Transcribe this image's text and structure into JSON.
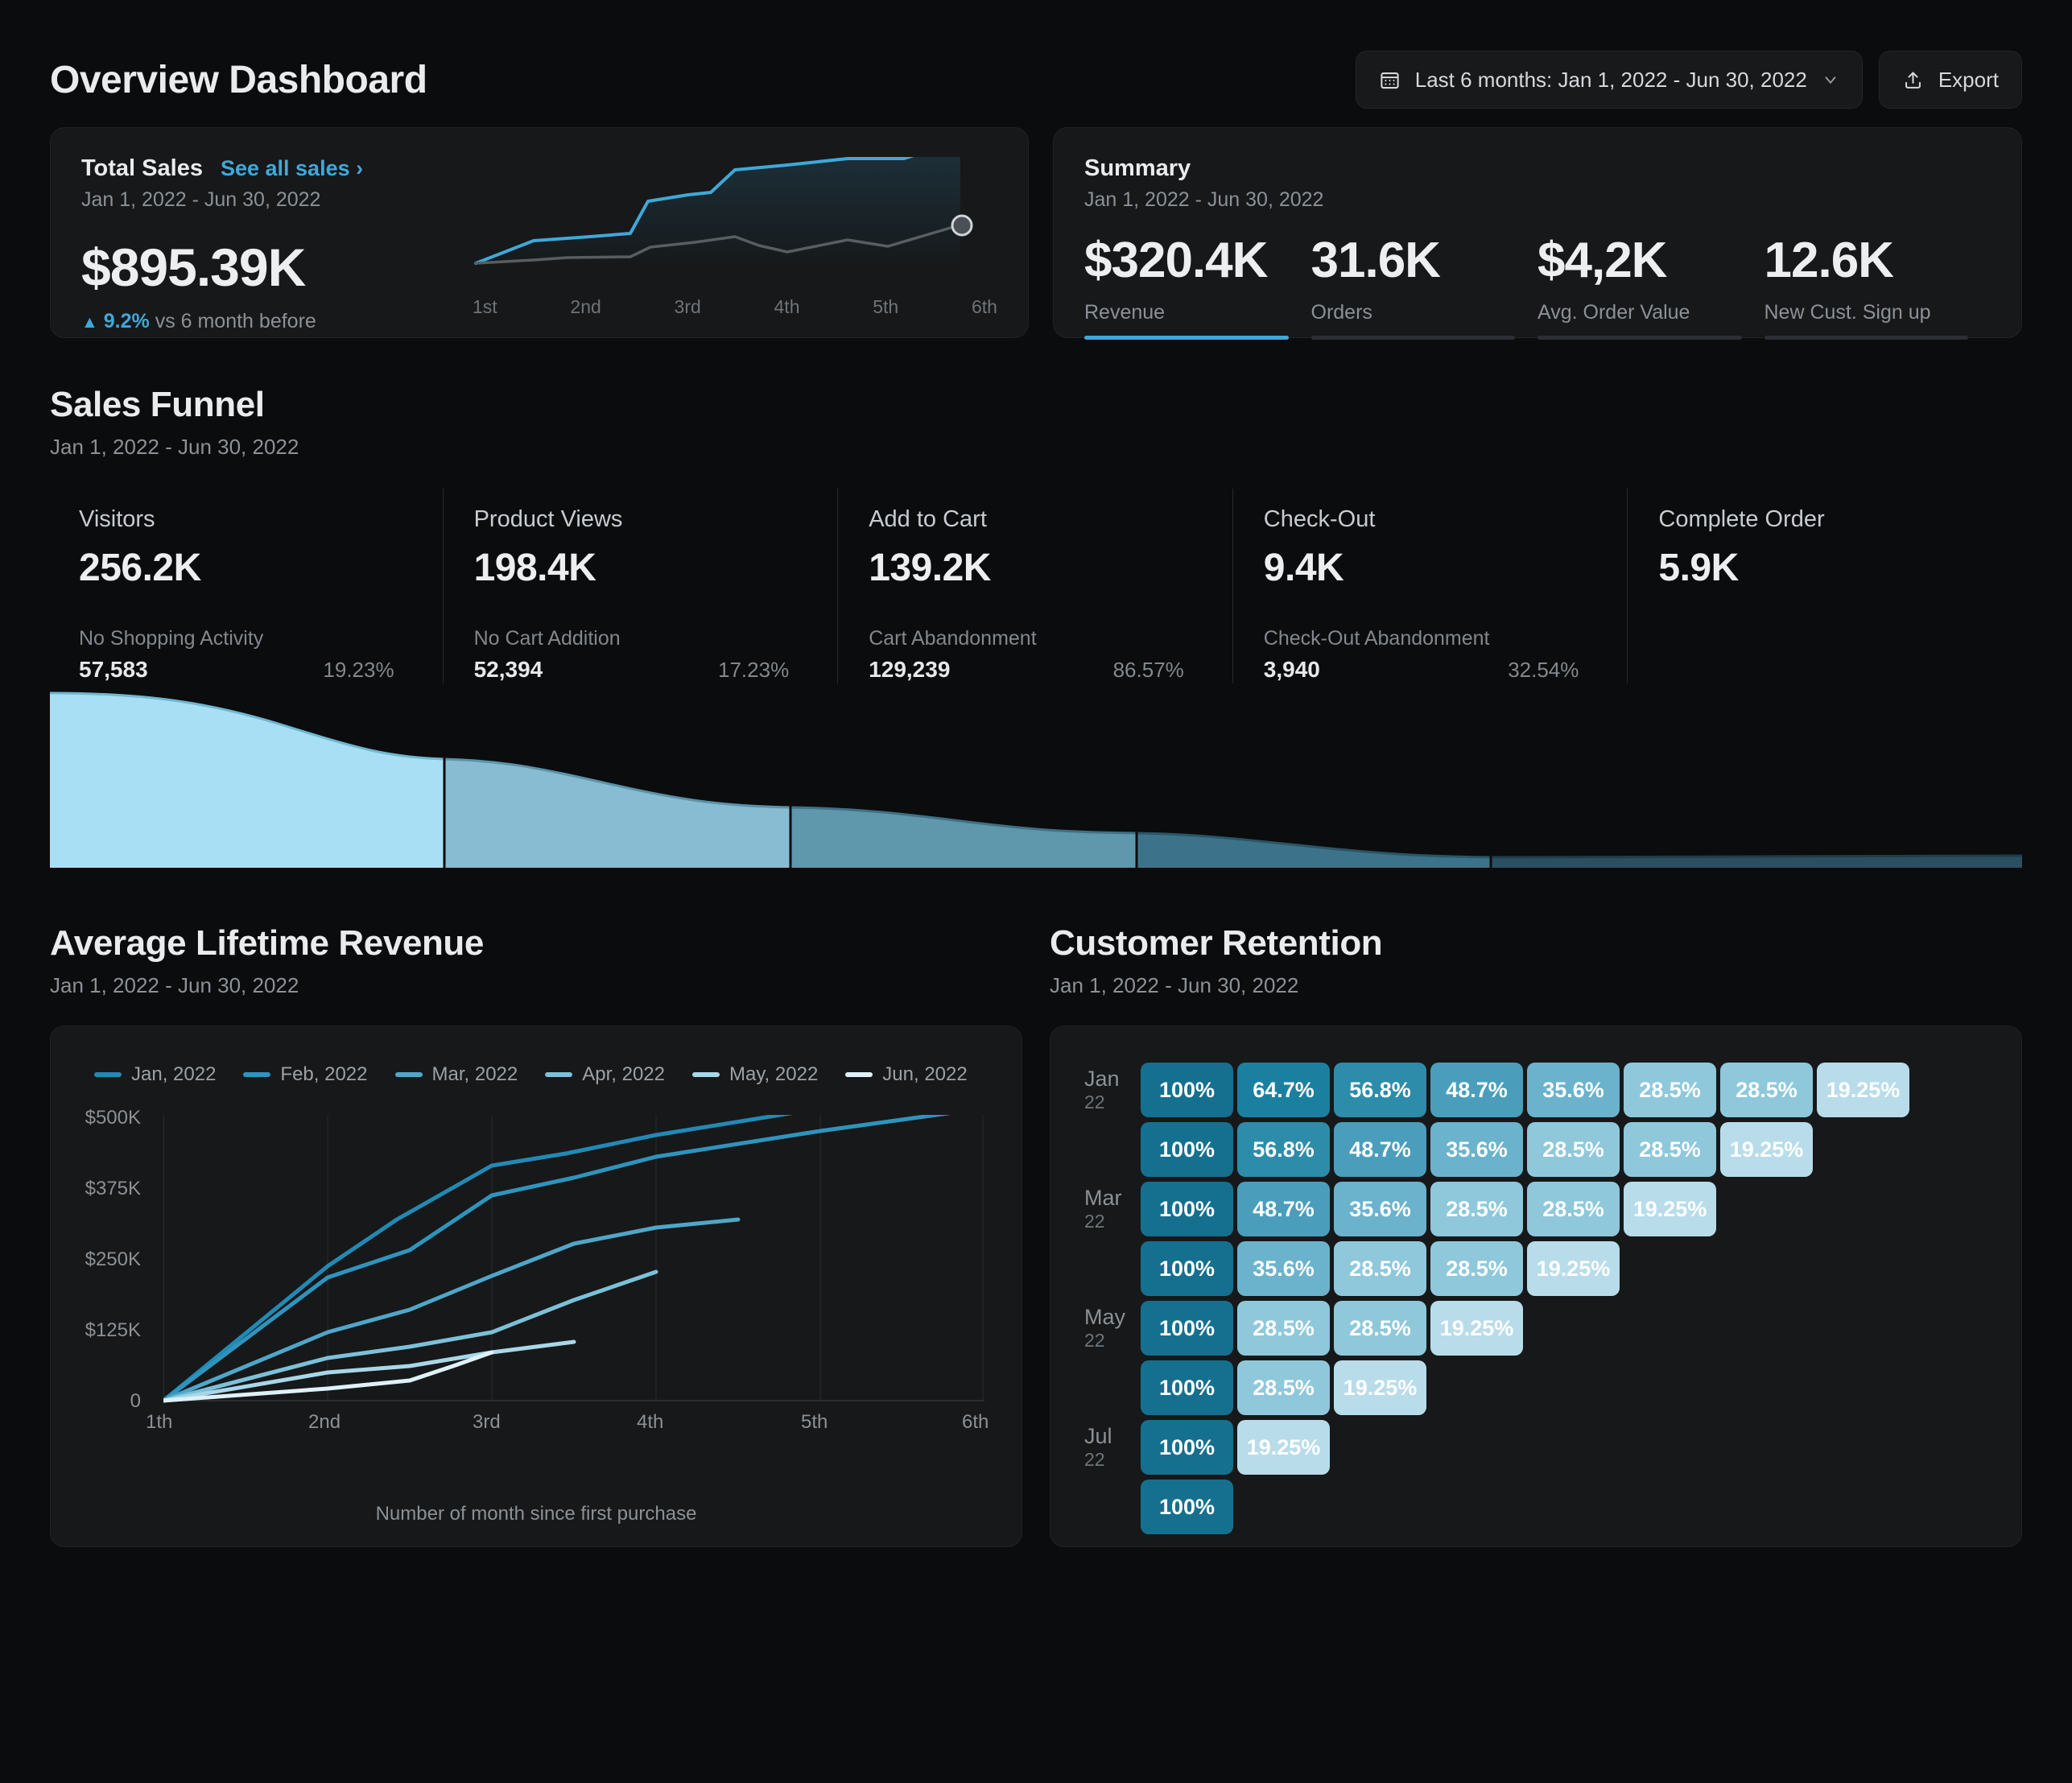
{
  "header": {
    "title": "Overview Dashboard",
    "date_picker": {
      "label": "Last 6 months: Jan 1, 2022 - Jun 30, 2022",
      "icon": "calendar-icon",
      "chevron": "∨"
    },
    "export": {
      "label": "Export",
      "icon": "upload-icon"
    }
  },
  "total_sales": {
    "title": "Total Sales",
    "link": "See all sales ›",
    "date_range": "Jan 1, 2022 - Jun 30, 2022",
    "value": "$895.39K",
    "delta_arrow": "▲",
    "delta_value": "9.2%",
    "delta_text": "vs 6 month before",
    "x_labels": [
      "1st",
      "2nd",
      "3rd",
      "4th",
      "5th",
      "6th"
    ]
  },
  "summary": {
    "title": "Summary",
    "date_range": "Jan 1, 2022 - Jun 30, 2022",
    "metrics": [
      {
        "value": "$320.4K",
        "label": "Revenue",
        "active": true
      },
      {
        "value": "31.6K",
        "label": "Orders",
        "active": false
      },
      {
        "value": "$4,2K",
        "label": "Avg. Order Value",
        "active": false
      },
      {
        "value": "12.6K",
        "label": "New Cust. Sign up",
        "active": false
      }
    ]
  },
  "sales_funnel": {
    "title": "Sales Funnel",
    "date_range": "Jan 1, 2022 - Jun 30, 2022",
    "stages": [
      {
        "label": "Visitors",
        "value": "256.2K",
        "drop_label": "No Shopping Activity",
        "drop_value": "57,583",
        "drop_pct": "19.23%",
        "color": "#a8dff5"
      },
      {
        "label": "Product Views",
        "value": "198.4K",
        "drop_label": "No Cart Addition",
        "drop_value": "52,394",
        "drop_pct": "17.23%",
        "color": "#87bcd2"
      },
      {
        "label": "Add to Cart",
        "value": "139.2K",
        "drop_label": "Cart Abandonment",
        "drop_value": "129,239",
        "drop_pct": "86.57%",
        "color": "#5f97ad"
      },
      {
        "label": "Check-Out",
        "value": "9.4K",
        "drop_label": "Check-Out Abandonment",
        "drop_value": "3,940",
        "drop_pct": "32.54%",
        "color": "#3c738b"
      },
      {
        "label": "Complete Order",
        "value": "5.9K",
        "drop_label": "",
        "drop_value": "",
        "drop_pct": "",
        "color": "#2a4f61"
      }
    ]
  },
  "lifetime_revenue": {
    "title": "Average Lifetime Revenue",
    "date_range": "Jan 1, 2022 - Jun 30, 2022"
  },
  "retention": {
    "title": "Customer Retention",
    "date_range": "Jan 1, 2022 - Jun 30, 2022"
  },
  "chart_data": [
    {
      "type": "line",
      "name": "total-sales-sparkline",
      "title": "Total Sales",
      "x": [
        "1st",
        "2nd",
        "3rd",
        "4th",
        "5th",
        "6th"
      ],
      "xlabel": "",
      "ylabel": "",
      "grid": false,
      "legend": "none",
      "series": [
        {
          "name": "current",
          "color": "#3fa8d8",
          "values": [
            5,
            28,
            33,
            62,
            70,
            80,
            86,
            86,
            100
          ]
        },
        {
          "name": "previous",
          "color": "#575d61",
          "values": [
            5,
            10,
            11,
            22,
            28,
            37,
            30,
            42,
            38,
            68
          ]
        }
      ]
    },
    {
      "type": "area",
      "name": "sales-funnel",
      "title": "Sales Funnel",
      "categories": [
        "Visitors",
        "Product Views",
        "Add to Cart",
        "Check-Out",
        "Complete Order"
      ],
      "values": [
        256200,
        198400,
        139200,
        9400,
        5900
      ],
      "value_labels": [
        "256.2K",
        "198.4K",
        "139.2K",
        "9.4K",
        "5.9K"
      ],
      "drop_labels": [
        "No Shopping Activity",
        "No Cart Addition",
        "Cart Abandonment",
        "Check-Out Abandonment",
        ""
      ],
      "drop_values": [
        57583,
        52394,
        129239,
        3940,
        null
      ],
      "drop_pcts": [
        19.23,
        17.23,
        86.57,
        32.54,
        null
      ],
      "colors": [
        "#a8dff5",
        "#87bcd2",
        "#5f97ad",
        "#3c738b",
        "#2a4f61"
      ]
    },
    {
      "type": "line",
      "name": "average-lifetime-revenue",
      "title": "Average Lifetime Revenue",
      "xlabel": "Number of month since first purchase",
      "ylabel": "",
      "x": [
        "1th",
        "2nd",
        "3rd",
        "4th",
        "5th",
        "6th"
      ],
      "y_ticks": [
        "0",
        "$125K",
        "$250K",
        "$375K",
        "$500K"
      ],
      "ylim": [
        0,
        500
      ],
      "grid": true,
      "legend": "top-left",
      "series": [
        {
          "name": "Jan, 2022",
          "color": "#2289b5",
          "values": [
            0,
            235,
            365,
            410,
            470,
            525
          ]
        },
        {
          "name": "Feb, 2022",
          "color": "#2e94bd",
          "values": [
            0,
            215,
            315,
            360,
            425,
            470
          ]
        },
        {
          "name": "Mar, 2022",
          "color": "#4fa6c9",
          "values": [
            0,
            120,
            218,
            288,
            310,
            null
          ]
        },
        {
          "name": "Apr, 2022",
          "color": "#7cc0d9",
          "values": [
            0,
            75,
            150,
            225,
            null,
            null
          ]
        },
        {
          "name": "May, 2022",
          "color": "#a8d7e9",
          "values": [
            0,
            62,
            110,
            null,
            null,
            null
          ]
        },
        {
          "name": "Jun, 2022",
          "color": "#dff1f8",
          "values": [
            0,
            30,
            78,
            null,
            null,
            null
          ]
        }
      ]
    },
    {
      "type": "heatmap",
      "name": "customer-retention",
      "title": "Customer Retention",
      "row_labels": [
        "Jan",
        "",
        "Mar",
        "",
        "May",
        "",
        "Jul",
        ""
      ],
      "row_years": [
        "22",
        "",
        "22",
        "",
        "22",
        "",
        "22",
        ""
      ],
      "values": [
        [
          "100%",
          "64.7%",
          "56.8%",
          "48.7%",
          "35.6%",
          "28.5%",
          "28.5%",
          "19.25%"
        ],
        [
          "100%",
          "56.8%",
          "48.7%",
          "35.6%",
          "28.5%",
          "28.5%",
          "19.25%"
        ],
        [
          "100%",
          "48.7%",
          "35.6%",
          "28.5%",
          "28.5%",
          "19.25%"
        ],
        [
          "100%",
          "35.6%",
          "28.5%",
          "28.5%",
          "19.25%"
        ],
        [
          "100%",
          "28.5%",
          "28.5%",
          "19.25%"
        ],
        [
          "100%",
          "28.5%",
          "19.25%"
        ],
        [
          "100%",
          "19.25%"
        ],
        [
          "100%"
        ]
      ],
      "color_scale": {
        "100%": "#15708f",
        "64.7%": "#1b7fa0",
        "56.8%": "#2d8caa",
        "48.7%": "#4a9ebc",
        "35.6%": "#6bb3cc",
        "28.5%": "#8fc8db",
        "19.25%": "#b8dcea"
      }
    }
  ]
}
